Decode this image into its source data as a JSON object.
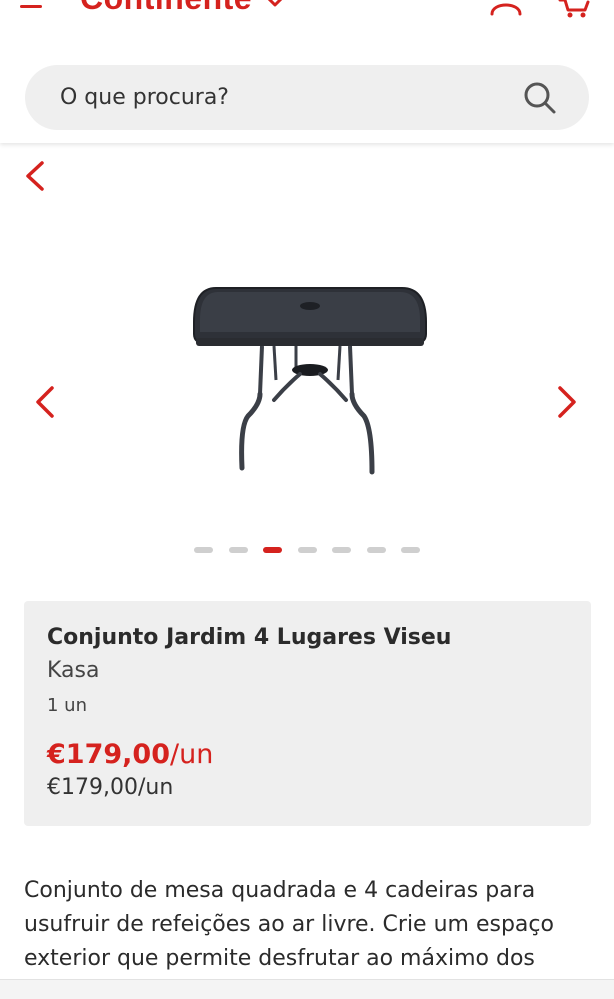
{
  "header": {
    "logo_text": "Continente",
    "brand_color": "#d5221e",
    "menu_icon": "hamburger-icon",
    "account_icon": "user-icon",
    "cart_icon": "cart-icon"
  },
  "search": {
    "placeholder": "O que procura?",
    "icon": "search-icon"
  },
  "carousel": {
    "back_icon": "chevron-left-icon",
    "prev_icon": "chevron-left-icon",
    "next_icon": "chevron-right-icon",
    "image_alt": "glass-top-garden-table",
    "total_slides": 7,
    "active_slide": 3
  },
  "product": {
    "name": "Conjunto Jardim 4 Lugares Viseu",
    "brand": "Kasa",
    "quantity": "1 un",
    "price": "€179,00",
    "price_unit": "/un",
    "unit_price": "€179,00/un"
  },
  "description": {
    "text": "Conjunto de mesa quadrada e 4 cadeiras para usufruir de refeições ao ar livre. Crie um espaço exterior que permite desfrutar ao máximo dos"
  }
}
